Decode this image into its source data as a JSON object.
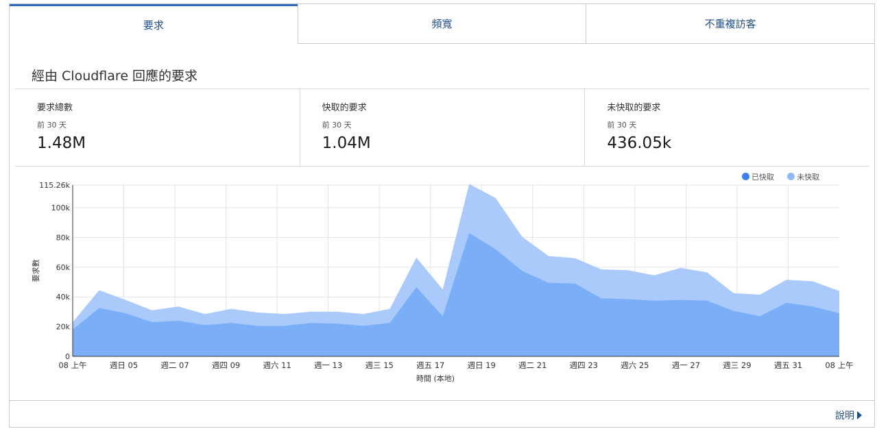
{
  "tabs": [
    {
      "label": "要求",
      "active": true
    },
    {
      "label": "頻寬",
      "active": false
    },
    {
      "label": "不重複訪客",
      "active": false
    }
  ],
  "section_title": "經由 Cloudflare 回應的要求",
  "stats": [
    {
      "label": "要求總數",
      "sub": "前 30 天",
      "value": "1.48M"
    },
    {
      "label": "快取的要求",
      "sub": "前 30 天",
      "value": "1.04M"
    },
    {
      "label": "未快取的要求",
      "sub": "前 30 天",
      "value": "436.05k"
    }
  ],
  "help_label": "說明",
  "colors": {
    "cached": "#7aaef7",
    "uncached": "#a9cafb",
    "accent": "#2a6ebb"
  },
  "chart_data": {
    "type": "area",
    "stacked": true,
    "ylabel": "要求數",
    "xlabel": "時間 (本地)",
    "ylim": [
      0,
      115260
    ],
    "y_ticks": [
      "0",
      "20k",
      "40k",
      "60k",
      "80k",
      "100k",
      "115.26k"
    ],
    "y_tick_values": [
      0,
      20000,
      40000,
      60000,
      80000,
      100000,
      115260
    ],
    "x_ticks": [
      "08 上午",
      "週日 05",
      "週二 07",
      "週四 09",
      "週六 11",
      "週一 13",
      "週三 15",
      "週五 17",
      "週日 19",
      "週二 21",
      "週四 23",
      "週六 25",
      "週一 27",
      "週三 29",
      "週五 31",
      "08 上午"
    ],
    "grid": true,
    "legend_position": "top-right",
    "series": [
      {
        "name": "已快取",
        "color": "#7aaef7",
        "values": [
          18000,
          32500,
          29000,
          23000,
          24000,
          21000,
          22500,
          20500,
          20500,
          22500,
          22000,
          20500,
          22500,
          46500,
          27000,
          83000,
          72000,
          57500,
          49500,
          49000,
          39000,
          38500,
          37500,
          38000,
          37500,
          30500,
          27000,
          36000,
          33500,
          29000
        ]
      },
      {
        "name": "未快取",
        "color": "#a9cafb",
        "values": [
          5000,
          12000,
          9000,
          8000,
          9500,
          7500,
          9500,
          9000,
          8000,
          7500,
          8000,
          8000,
          9500,
          20000,
          18000,
          33000,
          34500,
          23000,
          18000,
          17000,
          19500,
          19500,
          17000,
          21500,
          19000,
          12000,
          14500,
          15500,
          17000,
          15000
        ]
      }
    ]
  }
}
